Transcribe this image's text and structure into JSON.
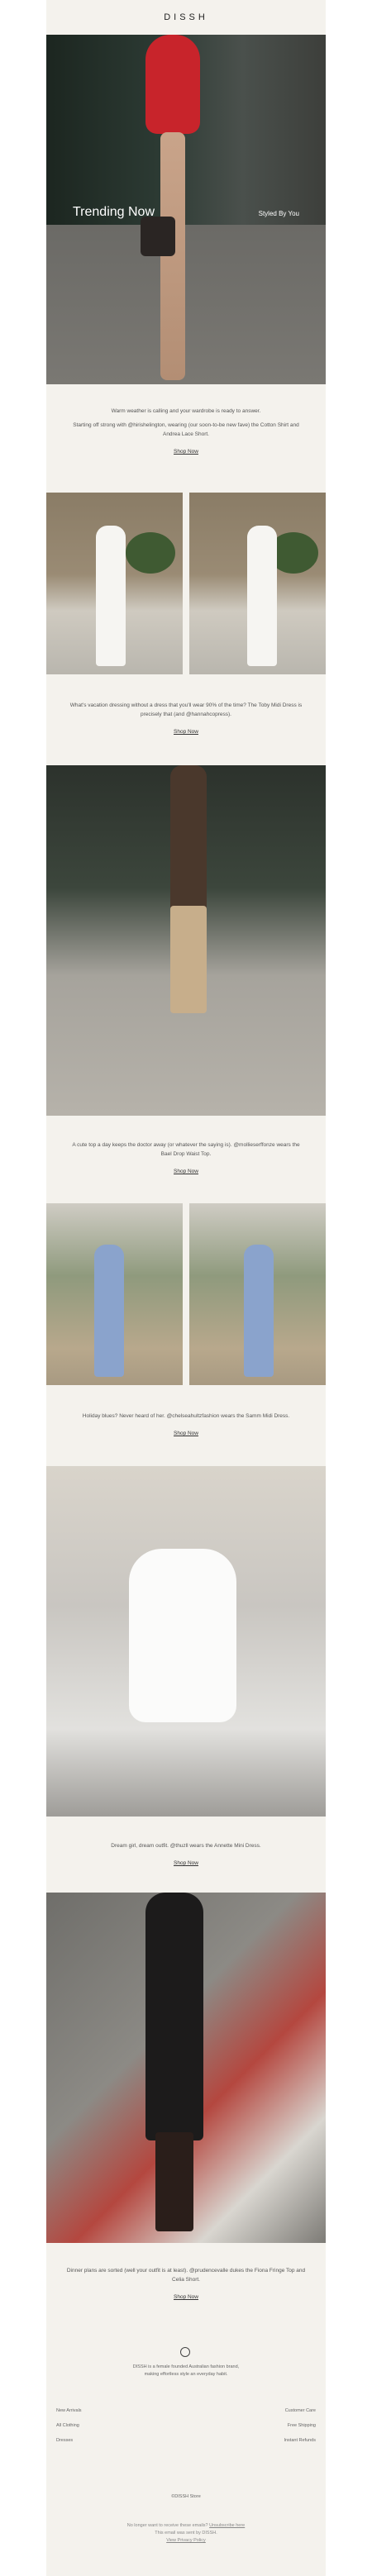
{
  "brand": {
    "logo": "DISSH"
  },
  "hero": {
    "title": "Trending Now",
    "styled_by": "Styled By You"
  },
  "sections": [
    {
      "paragraphs": [
        "Warm weather is calling and your wardrobe is ready to answer.",
        "Starting off strong with @hirishelington, wearing (our soon-to-be new fave) the Cotton Shirt and Andrea Lace Short."
      ],
      "cta": "Shop Now"
    },
    {
      "paragraphs": [
        "What's vacation dressing without a dress that you'll wear 90% of the time? The Toby Midi Dress is precisely that (and @hannahcopress)."
      ],
      "cta": "Shop Now"
    },
    {
      "paragraphs": [
        "A cute top a day keeps the doctor away (or whatever the saying is). @mollieserffonze wears the Bael Drop Waist Top."
      ],
      "cta": "Shop Now"
    },
    {
      "paragraphs": [
        "Holiday blues? Never heard of her. @chelseahultzfashion wears the Samm Midi Dress."
      ],
      "cta": "Shop Now"
    },
    {
      "paragraphs": [
        "Dream girl, dream outfit. @thuzll wears the Annette Mini Dress."
      ],
      "cta": "Shop Now"
    },
    {
      "paragraphs": [
        "Dinner plans are sorted (well your outfit is at least). @prudencevalle dukes the Fiona Fringe Top and Celia Short."
      ],
      "cta": "Shop Now"
    }
  ],
  "footer": {
    "about_lines": [
      "DISSH is a female founded Australian fashion brand,",
      "making effortless style an everyday habit."
    ],
    "links_left": [
      "New Arrivals",
      "All Clothing",
      "Dresses"
    ],
    "links_right": [
      "Customer Care",
      "Free Shipping",
      "Instant Refunds"
    ],
    "copyright": "©DISSH Store",
    "legal_line1": "No longer want to receive these emails?",
    "unsubscribe": "Unsubscribe here",
    "legal_line2": "This email was sent by DISSH.",
    "privacy": "View Privacy Policy"
  }
}
